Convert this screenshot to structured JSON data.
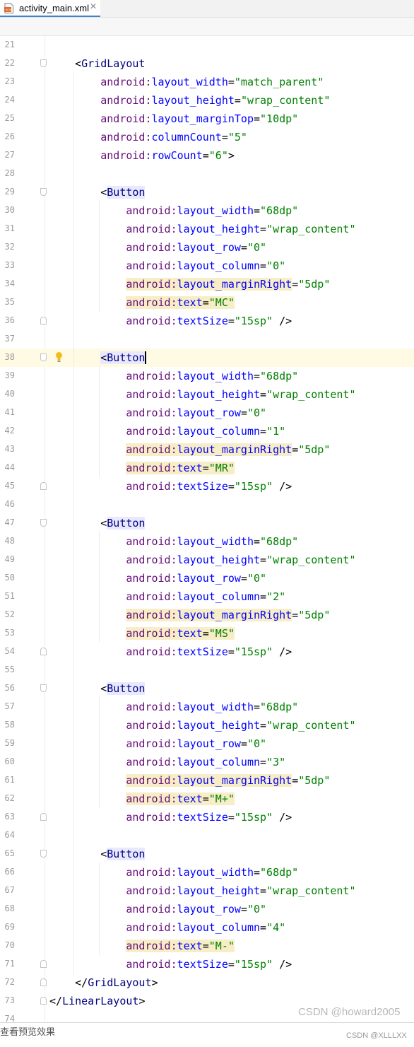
{
  "tab": {
    "filename": "activity_main.xml",
    "close_glyph": "✕",
    "icon": "xml-file-icon"
  },
  "editor": {
    "current_line": 38,
    "lines": [
      {
        "n": "21",
        "t": []
      },
      {
        "n": "22",
        "t": [
          [
            "p",
            "    <"
          ],
          [
            "tag",
            "GridLayout"
          ]
        ]
      },
      {
        "n": "23",
        "t": [
          [
            "p",
            "        "
          ],
          [
            "ns",
            "android:"
          ],
          [
            "attr",
            "layout_width"
          ],
          [
            "p",
            "="
          ],
          [
            "val",
            "\"match_parent\""
          ]
        ]
      },
      {
        "n": "24",
        "t": [
          [
            "p",
            "        "
          ],
          [
            "ns",
            "android:"
          ],
          [
            "attr",
            "layout_height"
          ],
          [
            "p",
            "="
          ],
          [
            "val",
            "\"wrap_content\""
          ]
        ]
      },
      {
        "n": "25",
        "t": [
          [
            "p",
            "        "
          ],
          [
            "ns",
            "android:"
          ],
          [
            "attr",
            "layout_marginTop"
          ],
          [
            "p",
            "="
          ],
          [
            "val",
            "\"10dp\""
          ]
        ]
      },
      {
        "n": "26",
        "t": [
          [
            "p",
            "        "
          ],
          [
            "ns",
            "android:"
          ],
          [
            "attr",
            "columnCount"
          ],
          [
            "p",
            "="
          ],
          [
            "val",
            "\"5\""
          ]
        ]
      },
      {
        "n": "27",
        "t": [
          [
            "p",
            "        "
          ],
          [
            "ns",
            "android:"
          ],
          [
            "attr",
            "rowCount"
          ],
          [
            "p",
            "="
          ],
          [
            "val",
            "\"6\""
          ],
          [
            "p",
            ">"
          ]
        ]
      },
      {
        "n": "28",
        "t": []
      },
      {
        "n": "29",
        "t": [
          [
            "p",
            "        <"
          ],
          [
            "tagb",
            "Button"
          ]
        ]
      },
      {
        "n": "30",
        "t": [
          [
            "p",
            "            "
          ],
          [
            "ns",
            "android:"
          ],
          [
            "attr",
            "layout_width"
          ],
          [
            "p",
            "="
          ],
          [
            "val",
            "\"68dp\""
          ]
        ]
      },
      {
        "n": "31",
        "t": [
          [
            "p",
            "            "
          ],
          [
            "ns",
            "android:"
          ],
          [
            "attr",
            "layout_height"
          ],
          [
            "p",
            "="
          ],
          [
            "val",
            "\"wrap_content\""
          ]
        ]
      },
      {
        "n": "32",
        "t": [
          [
            "p",
            "            "
          ],
          [
            "ns",
            "android:"
          ],
          [
            "attr",
            "layout_row"
          ],
          [
            "p",
            "="
          ],
          [
            "val",
            "\"0\""
          ]
        ]
      },
      {
        "n": "33",
        "t": [
          [
            "p",
            "            "
          ],
          [
            "ns",
            "android:"
          ],
          [
            "attr",
            "layout_column"
          ],
          [
            "p",
            "="
          ],
          [
            "val",
            "\"0\""
          ]
        ]
      },
      {
        "n": "34",
        "t": [
          [
            "p",
            "            "
          ],
          [
            "nsy",
            "android:"
          ],
          [
            "attry",
            "layout_marginRight"
          ],
          [
            "p",
            "="
          ],
          [
            "val",
            "\"5dp\""
          ]
        ]
      },
      {
        "n": "35",
        "t": [
          [
            "p",
            "            "
          ],
          [
            "nsy",
            "android:"
          ],
          [
            "attry",
            "text"
          ],
          [
            "py",
            "="
          ],
          [
            "valy",
            "\"MC\""
          ]
        ]
      },
      {
        "n": "36",
        "t": [
          [
            "p",
            "            "
          ],
          [
            "ns",
            "android:"
          ],
          [
            "attr",
            "textSize"
          ],
          [
            "p",
            "="
          ],
          [
            "val",
            "\"15sp\""
          ],
          [
            "p",
            " />"
          ]
        ]
      },
      {
        "n": "37",
        "t": []
      },
      {
        "n": "38",
        "t": [
          [
            "p",
            "        "
          ],
          [
            "pb",
            "<"
          ],
          [
            "tagb",
            "Button"
          ],
          [
            "caret",
            ""
          ]
        ]
      },
      {
        "n": "39",
        "t": [
          [
            "p",
            "            "
          ],
          [
            "ns",
            "android:"
          ],
          [
            "attr",
            "layout_width"
          ],
          [
            "p",
            "="
          ],
          [
            "val",
            "\"68dp\""
          ]
        ]
      },
      {
        "n": "40",
        "t": [
          [
            "p",
            "            "
          ],
          [
            "ns",
            "android:"
          ],
          [
            "attr",
            "layout_height"
          ],
          [
            "p",
            "="
          ],
          [
            "val",
            "\"wrap_content\""
          ]
        ]
      },
      {
        "n": "41",
        "t": [
          [
            "p",
            "            "
          ],
          [
            "ns",
            "android:"
          ],
          [
            "attr",
            "layout_row"
          ],
          [
            "p",
            "="
          ],
          [
            "val",
            "\"0\""
          ]
        ]
      },
      {
        "n": "42",
        "t": [
          [
            "p",
            "            "
          ],
          [
            "ns",
            "android:"
          ],
          [
            "attr",
            "layout_column"
          ],
          [
            "p",
            "="
          ],
          [
            "val",
            "\"1\""
          ]
        ]
      },
      {
        "n": "43",
        "t": [
          [
            "p",
            "            "
          ],
          [
            "nsy",
            "android:"
          ],
          [
            "attry",
            "layout_marginRight"
          ],
          [
            "p",
            "="
          ],
          [
            "val",
            "\"5dp\""
          ]
        ]
      },
      {
        "n": "44",
        "t": [
          [
            "p",
            "            "
          ],
          [
            "nsy",
            "android:"
          ],
          [
            "attry",
            "text"
          ],
          [
            "py",
            "="
          ],
          [
            "valy",
            "\"MR\""
          ]
        ]
      },
      {
        "n": "45",
        "t": [
          [
            "p",
            "            "
          ],
          [
            "ns",
            "android:"
          ],
          [
            "attr",
            "textSize"
          ],
          [
            "p",
            "="
          ],
          [
            "val",
            "\"15sp\""
          ],
          [
            "p",
            " />"
          ]
        ]
      },
      {
        "n": "46",
        "t": []
      },
      {
        "n": "47",
        "t": [
          [
            "p",
            "        <"
          ],
          [
            "tagb",
            "Button"
          ]
        ]
      },
      {
        "n": "48",
        "t": [
          [
            "p",
            "            "
          ],
          [
            "ns",
            "android:"
          ],
          [
            "attr",
            "layout_width"
          ],
          [
            "p",
            "="
          ],
          [
            "val",
            "\"68dp\""
          ]
        ]
      },
      {
        "n": "49",
        "t": [
          [
            "p",
            "            "
          ],
          [
            "ns",
            "android:"
          ],
          [
            "attr",
            "layout_height"
          ],
          [
            "p",
            "="
          ],
          [
            "val",
            "\"wrap_content\""
          ]
        ]
      },
      {
        "n": "50",
        "t": [
          [
            "p",
            "            "
          ],
          [
            "ns",
            "android:"
          ],
          [
            "attr",
            "layout_row"
          ],
          [
            "p",
            "="
          ],
          [
            "val",
            "\"0\""
          ]
        ]
      },
      {
        "n": "51",
        "t": [
          [
            "p",
            "            "
          ],
          [
            "ns",
            "android:"
          ],
          [
            "attr",
            "layout_column"
          ],
          [
            "p",
            "="
          ],
          [
            "val",
            "\"2\""
          ]
        ]
      },
      {
        "n": "52",
        "t": [
          [
            "p",
            "            "
          ],
          [
            "nsy",
            "android:"
          ],
          [
            "attry",
            "layout_marginRight"
          ],
          [
            "p",
            "="
          ],
          [
            "val",
            "\"5dp\""
          ]
        ]
      },
      {
        "n": "53",
        "t": [
          [
            "p",
            "            "
          ],
          [
            "nsy",
            "android:"
          ],
          [
            "attry",
            "text"
          ],
          [
            "py",
            "="
          ],
          [
            "valy",
            "\"MS\""
          ]
        ]
      },
      {
        "n": "54",
        "t": [
          [
            "p",
            "            "
          ],
          [
            "ns",
            "android:"
          ],
          [
            "attr",
            "textSize"
          ],
          [
            "p",
            "="
          ],
          [
            "val",
            "\"15sp\""
          ],
          [
            "p",
            " />"
          ]
        ]
      },
      {
        "n": "55",
        "t": []
      },
      {
        "n": "56",
        "t": [
          [
            "p",
            "        <"
          ],
          [
            "tagb",
            "Button"
          ]
        ]
      },
      {
        "n": "57",
        "t": [
          [
            "p",
            "            "
          ],
          [
            "ns",
            "android:"
          ],
          [
            "attr",
            "layout_width"
          ],
          [
            "p",
            "="
          ],
          [
            "val",
            "\"68dp\""
          ]
        ]
      },
      {
        "n": "58",
        "t": [
          [
            "p",
            "            "
          ],
          [
            "ns",
            "android:"
          ],
          [
            "attr",
            "layout_height"
          ],
          [
            "p",
            "="
          ],
          [
            "val",
            "\"wrap_content\""
          ]
        ]
      },
      {
        "n": "59",
        "t": [
          [
            "p",
            "            "
          ],
          [
            "ns",
            "android:"
          ],
          [
            "attr",
            "layout_row"
          ],
          [
            "p",
            "="
          ],
          [
            "val",
            "\"0\""
          ]
        ]
      },
      {
        "n": "60",
        "t": [
          [
            "p",
            "            "
          ],
          [
            "ns",
            "android:"
          ],
          [
            "attr",
            "layout_column"
          ],
          [
            "p",
            "="
          ],
          [
            "val",
            "\"3\""
          ]
        ]
      },
      {
        "n": "61",
        "t": [
          [
            "p",
            "            "
          ],
          [
            "nsy",
            "android:"
          ],
          [
            "attry",
            "layout_marginRight"
          ],
          [
            "p",
            "="
          ],
          [
            "val",
            "\"5dp\""
          ]
        ]
      },
      {
        "n": "62",
        "t": [
          [
            "p",
            "            "
          ],
          [
            "nsy",
            "android:"
          ],
          [
            "attry",
            "text"
          ],
          [
            "py",
            "="
          ],
          [
            "valy",
            "\"M+\""
          ]
        ]
      },
      {
        "n": "63",
        "t": [
          [
            "p",
            "            "
          ],
          [
            "ns",
            "android:"
          ],
          [
            "attr",
            "textSize"
          ],
          [
            "p",
            "="
          ],
          [
            "val",
            "\"15sp\""
          ],
          [
            "p",
            " />"
          ]
        ]
      },
      {
        "n": "64",
        "t": []
      },
      {
        "n": "65",
        "t": [
          [
            "p",
            "        <"
          ],
          [
            "tagb",
            "Button"
          ]
        ]
      },
      {
        "n": "66",
        "t": [
          [
            "p",
            "            "
          ],
          [
            "ns",
            "android:"
          ],
          [
            "attr",
            "layout_width"
          ],
          [
            "p",
            "="
          ],
          [
            "val",
            "\"68dp\""
          ]
        ]
      },
      {
        "n": "67",
        "t": [
          [
            "p",
            "            "
          ],
          [
            "ns",
            "android:"
          ],
          [
            "attr",
            "layout_height"
          ],
          [
            "p",
            "="
          ],
          [
            "val",
            "\"wrap_content\""
          ]
        ]
      },
      {
        "n": "68",
        "t": [
          [
            "p",
            "            "
          ],
          [
            "ns",
            "android:"
          ],
          [
            "attr",
            "layout_row"
          ],
          [
            "p",
            "="
          ],
          [
            "val",
            "\"0\""
          ]
        ]
      },
      {
        "n": "69",
        "t": [
          [
            "p",
            "            "
          ],
          [
            "ns",
            "android:"
          ],
          [
            "attr",
            "layout_column"
          ],
          [
            "p",
            "="
          ],
          [
            "val",
            "\"4\""
          ]
        ]
      },
      {
        "n": "70",
        "t": [
          [
            "p",
            "            "
          ],
          [
            "nsy",
            "android:"
          ],
          [
            "attry",
            "text"
          ],
          [
            "py",
            "="
          ],
          [
            "valy",
            "\"M-\""
          ]
        ]
      },
      {
        "n": "71",
        "t": [
          [
            "p",
            "            "
          ],
          [
            "ns",
            "android:"
          ],
          [
            "attr",
            "textSize"
          ],
          [
            "p",
            "="
          ],
          [
            "val",
            "\"15sp\""
          ],
          [
            "p",
            " />"
          ]
        ]
      },
      {
        "n": "72",
        "t": [
          [
            "p",
            "    </"
          ],
          [
            "tag",
            "GridLayout"
          ],
          [
            "p",
            ">"
          ]
        ]
      },
      {
        "n": "73",
        "t": [
          [
            "p",
            "</"
          ],
          [
            "tag",
            "LinearLayout"
          ],
          [
            "p",
            ">"
          ]
        ]
      },
      {
        "n": "74",
        "t": []
      }
    ]
  },
  "bottom_text": "查看预览效果",
  "watermarks": {
    "main": "CSDN @howard2005",
    "small": "CSDN @XLLLXX"
  },
  "colors": {
    "tag": "#000080",
    "namespace": "#660e7a",
    "attribute": "#0000ff",
    "value": "#008000",
    "current_line": "#fffae3",
    "usage_highlight": "#f7edc6",
    "tag_highlight": "#e8e8ff"
  }
}
